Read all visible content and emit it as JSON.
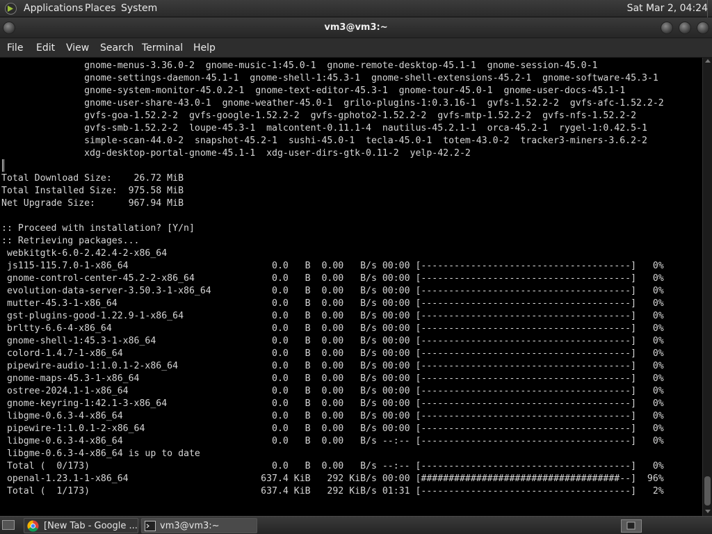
{
  "top_panel": {
    "menus": [
      "Applications",
      "Places",
      "System"
    ],
    "clock": "Sat Mar  2, 04:24"
  },
  "window": {
    "title": "vm3@vm3:~"
  },
  "menubar": {
    "items": [
      "File",
      "Edit",
      "View",
      "Search",
      "Terminal",
      "Help"
    ]
  },
  "terminal": {
    "lines": [
      "               gnome-menus-3.36.0-2  gnome-music-1:45.0-1  gnome-remote-desktop-45.1-1  gnome-session-45.0-1",
      "               gnome-settings-daemon-45.1-1  gnome-shell-1:45.3-1  gnome-shell-extensions-45.2-1  gnome-software-45.3-1",
      "               gnome-system-monitor-45.0.2-1  gnome-text-editor-45.3-1  gnome-tour-45.0-1  gnome-user-docs-45.1-1",
      "               gnome-user-share-43.0-1  gnome-weather-45.0-1  grilo-plugins-1:0.3.16-1  gvfs-1.52.2-2  gvfs-afc-1.52.2-2",
      "               gvfs-goa-1.52.2-2  gvfs-google-1.52.2-2  gvfs-gphoto2-1.52.2-2  gvfs-mtp-1.52.2-2  gvfs-nfs-1.52.2-2",
      "               gvfs-smb-1.52.2-2  loupe-45.3-1  malcontent-0.11.1-4  nautilus-45.2.1-1  orca-45.2-1  rygel-1:0.42.5-1",
      "               simple-scan-44.0-2  snapshot-45.2-1  sushi-45.0-1  tecla-45.0-1  totem-43.0-2  tracker3-miners-3.6.2-2",
      "               xdg-desktop-portal-gnome-45.1-1  xdg-user-dirs-gtk-0.11-2  yelp-42.2-2",
      "",
      "Total Download Size:    26.72 MiB",
      "Total Installed Size:  975.58 MiB",
      "Net Upgrade Size:      967.94 MiB",
      "",
      ":: Proceed with installation? [Y/n]",
      ":: Retrieving packages...",
      " webkitgtk-6.0-2.42.4-2-x86_64",
      " js115-115.7.0-1-x86_64                          0.0   B  0.00   B/s 00:00 [--------------------------------------]   0%",
      " gnome-control-center-45.2-2-x86_64              0.0   B  0.00   B/s 00:00 [--------------------------------------]   0%",
      " evolution-data-server-3.50.3-1-x86_64           0.0   B  0.00   B/s 00:00 [--------------------------------------]   0%",
      " mutter-45.3-1-x86_64                            0.0   B  0.00   B/s 00:00 [--------------------------------------]   0%",
      " gst-plugins-good-1.22.9-1-x86_64                0.0   B  0.00   B/s 00:00 [--------------------------------------]   0%",
      " brltty-6.6-4-x86_64                             0.0   B  0.00   B/s 00:00 [--------------------------------------]   0%",
      " gnome-shell-1:45.3-1-x86_64                     0.0   B  0.00   B/s 00:00 [--------------------------------------]   0%",
      " colord-1.4.7-1-x86_64                           0.0   B  0.00   B/s 00:00 [--------------------------------------]   0%",
      " pipewire-audio-1:1.0.1-2-x86_64                 0.0   B  0.00   B/s 00:00 [--------------------------------------]   0%",
      " gnome-maps-45.3-1-x86_64                        0.0   B  0.00   B/s 00:00 [--------------------------------------]   0%",
      " ostree-2024.1-1-x86_64                          0.0   B  0.00   B/s 00:00 [--------------------------------------]   0%",
      " gnome-keyring-1:42.1-3-x86_64                   0.0   B  0.00   B/s 00:00 [--------------------------------------]   0%",
      " libgme-0.6.3-4-x86_64                           0.0   B  0.00   B/s 00:00 [--------------------------------------]   0%",
      " pipewire-1:1.0.1-2-x86_64                       0.0   B  0.00   B/s 00:00 [--------------------------------------]   0%",
      " libgme-0.6.3-4-x86_64                           0.0   B  0.00   B/s --:-- [--------------------------------------]   0%",
      " libgme-0.6.3-4-x86_64 is up to date",
      " Total (  0/173)                                 0.0   B  0.00   B/s --:-- [--------------------------------------]   0%",
      " openal-1.23.1-1-x86_64                        637.4 KiB   292 KiB/s 00:00 [####################################--]  96%",
      " Total (  1/173)                               637.4 KiB   292 KiB/s 01:31 [--------------------------------------]   2%"
    ]
  },
  "taskbar": {
    "tasks": [
      "[New Tab - Google ...",
      "vm3@vm3:~"
    ]
  }
}
